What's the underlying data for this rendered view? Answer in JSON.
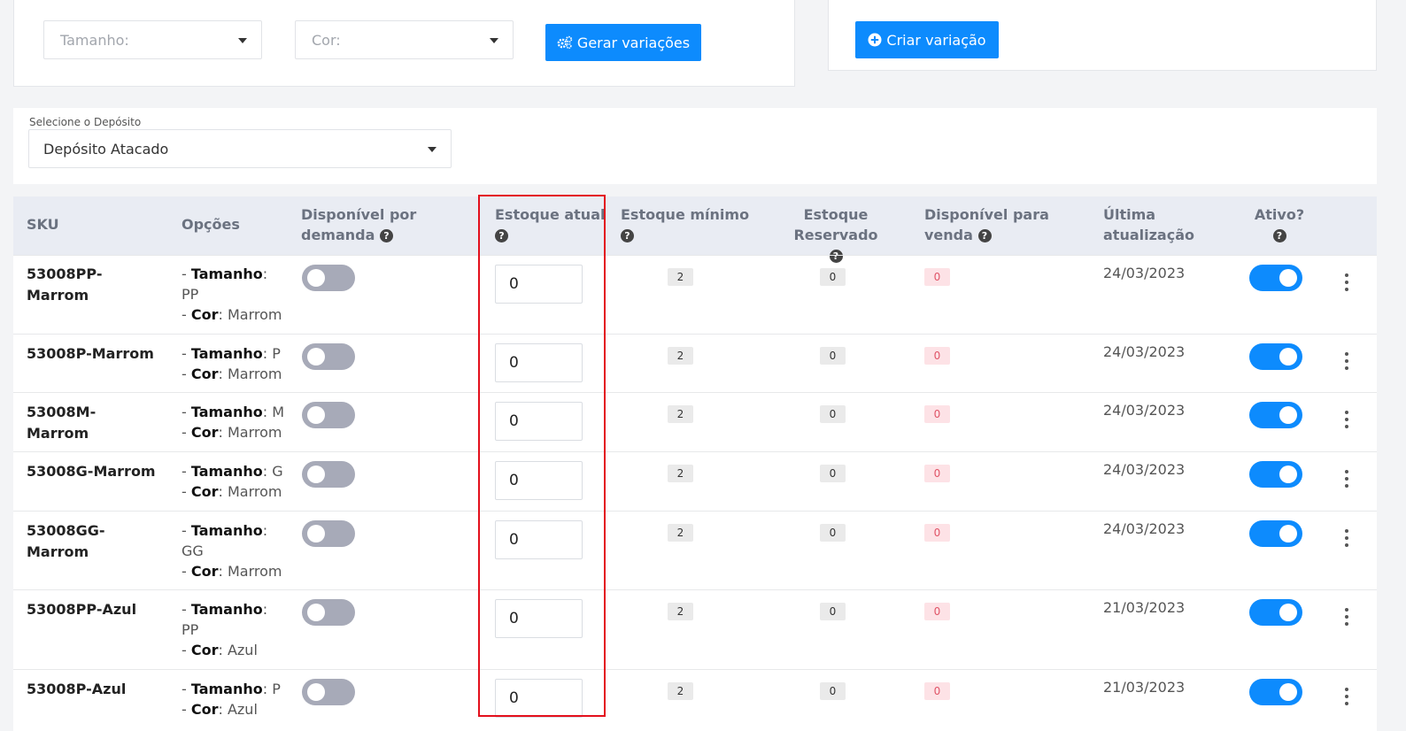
{
  "top_left": {
    "size_placeholder": "Tamanho:",
    "color_placeholder": "Cor:",
    "generate_button": "Gerar variações"
  },
  "top_right": {
    "create_button": "Criar variação"
  },
  "deposit": {
    "label": "Selecione o Depósito",
    "value": "Depósito Atacado"
  },
  "table": {
    "headers": {
      "sku": "SKU",
      "options": "Opções",
      "on_demand_1": "Disponível por",
      "on_demand_2": "demanda",
      "current_stock": "Estoque atual",
      "min_stock": "Estoque mínimo",
      "reserved": "Estoque Reservado",
      "available_1": "Disponível para",
      "available_2": "venda",
      "last_update_1": "Última",
      "last_update_2": "atualização",
      "active": "Ativo?"
    },
    "option_labels": {
      "size": "Tamanho",
      "color": "Cor"
    },
    "rows": [
      {
        "sku": "53008PP-Marrom",
        "size": "PP",
        "color": "Marrom",
        "stock": "0",
        "min": "2",
        "reserved": "0",
        "available": "0",
        "date": "24/03/2023"
      },
      {
        "sku": "53008P-Marrom",
        "size": "P",
        "color": "Marrom",
        "stock": "0",
        "min": "2",
        "reserved": "0",
        "available": "0",
        "date": "24/03/2023"
      },
      {
        "sku": "53008M-Marrom",
        "size": "M",
        "color": "Marrom",
        "stock": "0",
        "min": "2",
        "reserved": "0",
        "available": "0",
        "date": "24/03/2023"
      },
      {
        "sku": "53008G-Marrom",
        "size": "G",
        "color": "Marrom",
        "stock": "0",
        "min": "2",
        "reserved": "0",
        "available": "0",
        "date": "24/03/2023"
      },
      {
        "sku": "53008GG-Marrom",
        "size": "GG",
        "color": "Marrom",
        "stock": "0",
        "min": "2",
        "reserved": "0",
        "available": "0",
        "date": "24/03/2023"
      },
      {
        "sku": "53008PP-Azul",
        "size": "PP",
        "color": "Azul",
        "stock": "0",
        "min": "2",
        "reserved": "0",
        "available": "0",
        "date": "21/03/2023"
      },
      {
        "sku": "53008P-Azul",
        "size": "P",
        "color": "Azul",
        "stock": "0",
        "min": "2",
        "reserved": "0",
        "available": "0",
        "date": "21/03/2023"
      }
    ]
  },
  "colors": {
    "primary": "#0d8bfd",
    "highlight": "#e3101c",
    "toggle_off": "#a7aab8",
    "badge_alert": "#fde2e6"
  }
}
